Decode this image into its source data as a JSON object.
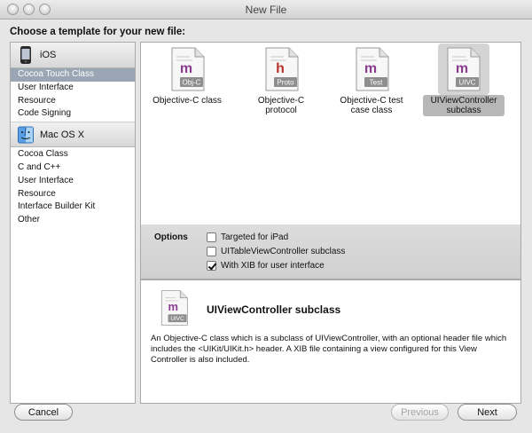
{
  "window": {
    "title": "New File"
  },
  "heading": "Choose a template for your new file:",
  "sidebar": {
    "sections": [
      {
        "platform": "iOS",
        "items": [
          "Cocoa Touch Class",
          "User Interface",
          "Resource",
          "Code Signing"
        ],
        "selected_index": 0
      },
      {
        "platform": "Mac OS X",
        "items": [
          "Cocoa Class",
          "C and C++",
          "User Interface",
          "Resource",
          "Interface Builder Kit",
          "Other"
        ]
      }
    ]
  },
  "templates": [
    {
      "label": "Objective-C class",
      "badge": "Obj-C",
      "letter": "m",
      "letter_color": "#8a3d8f"
    },
    {
      "label": "Objective-C protocol",
      "badge": "Proto",
      "letter": "h",
      "letter_color": "#b8342c"
    },
    {
      "label": "Objective-C test case class",
      "badge": "Test",
      "letter": "m",
      "letter_color": "#8a3d8f"
    },
    {
      "label": "UIViewController subclass",
      "badge": "UIVC",
      "letter": "m",
      "letter_color": "#8a3d8f",
      "selected": true
    }
  ],
  "options": {
    "title": "Options",
    "items": [
      {
        "label": "Targeted for iPad",
        "checked": false
      },
      {
        "label": "UITableViewController subclass",
        "checked": false
      },
      {
        "label": "With XIB for user interface",
        "checked": true
      }
    ]
  },
  "detail": {
    "title": "UIViewController subclass",
    "badge": "UIVC",
    "letter": "m",
    "description": "An Objective-C class which is a subclass of UIViewController, with an optional header file which includes the <UIKit/UIKit.h> header. A XIB file containing a view configured for this View Controller is also included."
  },
  "buttons": {
    "cancel": "Cancel",
    "previous": "Previous",
    "next": "Next"
  }
}
